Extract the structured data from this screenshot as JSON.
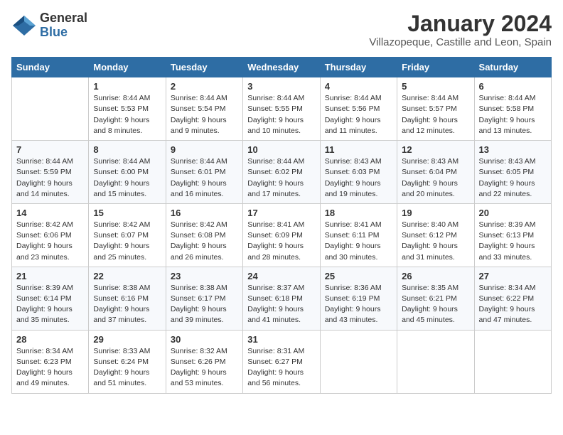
{
  "header": {
    "logo_general": "General",
    "logo_blue": "Blue",
    "month": "January 2024",
    "location": "Villazopeque, Castille and Leon, Spain"
  },
  "weekdays": [
    "Sunday",
    "Monday",
    "Tuesday",
    "Wednesday",
    "Thursday",
    "Friday",
    "Saturday"
  ],
  "weeks": [
    [
      {
        "day": "",
        "info": ""
      },
      {
        "day": "1",
        "info": "Sunrise: 8:44 AM\nSunset: 5:53 PM\nDaylight: 9 hours\nand 8 minutes."
      },
      {
        "day": "2",
        "info": "Sunrise: 8:44 AM\nSunset: 5:54 PM\nDaylight: 9 hours\nand 9 minutes."
      },
      {
        "day": "3",
        "info": "Sunrise: 8:44 AM\nSunset: 5:55 PM\nDaylight: 9 hours\nand 10 minutes."
      },
      {
        "day": "4",
        "info": "Sunrise: 8:44 AM\nSunset: 5:56 PM\nDaylight: 9 hours\nand 11 minutes."
      },
      {
        "day": "5",
        "info": "Sunrise: 8:44 AM\nSunset: 5:57 PM\nDaylight: 9 hours\nand 12 minutes."
      },
      {
        "day": "6",
        "info": "Sunrise: 8:44 AM\nSunset: 5:58 PM\nDaylight: 9 hours\nand 13 minutes."
      }
    ],
    [
      {
        "day": "7",
        "info": "Sunrise: 8:44 AM\nSunset: 5:59 PM\nDaylight: 9 hours\nand 14 minutes."
      },
      {
        "day": "8",
        "info": "Sunrise: 8:44 AM\nSunset: 6:00 PM\nDaylight: 9 hours\nand 15 minutes."
      },
      {
        "day": "9",
        "info": "Sunrise: 8:44 AM\nSunset: 6:01 PM\nDaylight: 9 hours\nand 16 minutes."
      },
      {
        "day": "10",
        "info": "Sunrise: 8:44 AM\nSunset: 6:02 PM\nDaylight: 9 hours\nand 17 minutes."
      },
      {
        "day": "11",
        "info": "Sunrise: 8:43 AM\nSunset: 6:03 PM\nDaylight: 9 hours\nand 19 minutes."
      },
      {
        "day": "12",
        "info": "Sunrise: 8:43 AM\nSunset: 6:04 PM\nDaylight: 9 hours\nand 20 minutes."
      },
      {
        "day": "13",
        "info": "Sunrise: 8:43 AM\nSunset: 6:05 PM\nDaylight: 9 hours\nand 22 minutes."
      }
    ],
    [
      {
        "day": "14",
        "info": "Sunrise: 8:42 AM\nSunset: 6:06 PM\nDaylight: 9 hours\nand 23 minutes."
      },
      {
        "day": "15",
        "info": "Sunrise: 8:42 AM\nSunset: 6:07 PM\nDaylight: 9 hours\nand 25 minutes."
      },
      {
        "day": "16",
        "info": "Sunrise: 8:42 AM\nSunset: 6:08 PM\nDaylight: 9 hours\nand 26 minutes."
      },
      {
        "day": "17",
        "info": "Sunrise: 8:41 AM\nSunset: 6:09 PM\nDaylight: 9 hours\nand 28 minutes."
      },
      {
        "day": "18",
        "info": "Sunrise: 8:41 AM\nSunset: 6:11 PM\nDaylight: 9 hours\nand 30 minutes."
      },
      {
        "day": "19",
        "info": "Sunrise: 8:40 AM\nSunset: 6:12 PM\nDaylight: 9 hours\nand 31 minutes."
      },
      {
        "day": "20",
        "info": "Sunrise: 8:39 AM\nSunset: 6:13 PM\nDaylight: 9 hours\nand 33 minutes."
      }
    ],
    [
      {
        "day": "21",
        "info": "Sunrise: 8:39 AM\nSunset: 6:14 PM\nDaylight: 9 hours\nand 35 minutes."
      },
      {
        "day": "22",
        "info": "Sunrise: 8:38 AM\nSunset: 6:16 PM\nDaylight: 9 hours\nand 37 minutes."
      },
      {
        "day": "23",
        "info": "Sunrise: 8:38 AM\nSunset: 6:17 PM\nDaylight: 9 hours\nand 39 minutes."
      },
      {
        "day": "24",
        "info": "Sunrise: 8:37 AM\nSunset: 6:18 PM\nDaylight: 9 hours\nand 41 minutes."
      },
      {
        "day": "25",
        "info": "Sunrise: 8:36 AM\nSunset: 6:19 PM\nDaylight: 9 hours\nand 43 minutes."
      },
      {
        "day": "26",
        "info": "Sunrise: 8:35 AM\nSunset: 6:21 PM\nDaylight: 9 hours\nand 45 minutes."
      },
      {
        "day": "27",
        "info": "Sunrise: 8:34 AM\nSunset: 6:22 PM\nDaylight: 9 hours\nand 47 minutes."
      }
    ],
    [
      {
        "day": "28",
        "info": "Sunrise: 8:34 AM\nSunset: 6:23 PM\nDaylight: 9 hours\nand 49 minutes."
      },
      {
        "day": "29",
        "info": "Sunrise: 8:33 AM\nSunset: 6:24 PM\nDaylight: 9 hours\nand 51 minutes."
      },
      {
        "day": "30",
        "info": "Sunrise: 8:32 AM\nSunset: 6:26 PM\nDaylight: 9 hours\nand 53 minutes."
      },
      {
        "day": "31",
        "info": "Sunrise: 8:31 AM\nSunset: 6:27 PM\nDaylight: 9 hours\nand 56 minutes."
      },
      {
        "day": "",
        "info": ""
      },
      {
        "day": "",
        "info": ""
      },
      {
        "day": "",
        "info": ""
      }
    ]
  ]
}
